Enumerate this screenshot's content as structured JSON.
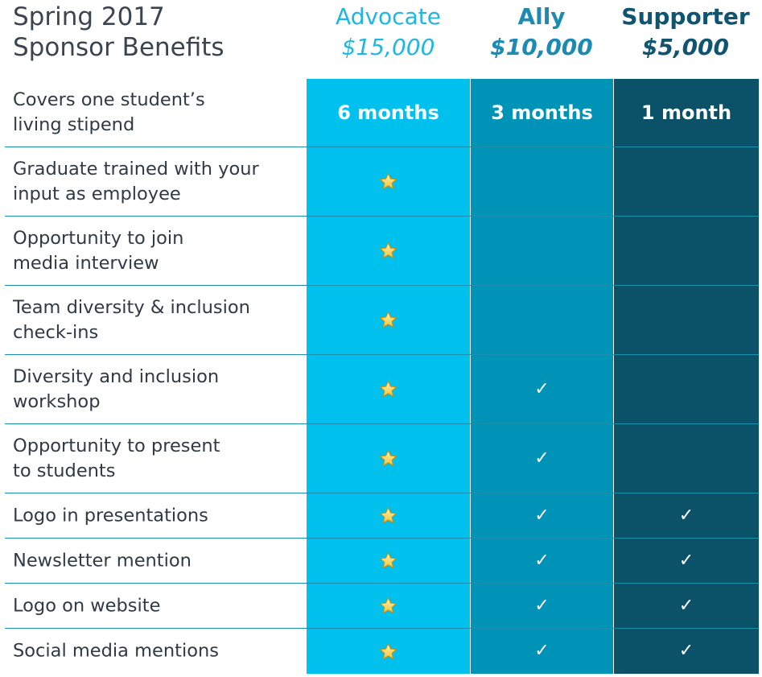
{
  "header": {
    "title_line1": "Spring 2017",
    "title_line2": "Sponsor Benefits"
  },
  "tiers": [
    {
      "name": "Advocate",
      "price": "$15,000",
      "color": "#00c0ee"
    },
    {
      "name": "Ally",
      "price": "$10,000",
      "color": "#0093b8"
    },
    {
      "name": "Supporter",
      "price": "$5,000",
      "color": "#0b5269"
    }
  ],
  "icons": {
    "star": "star-icon",
    "check": "check-icon",
    "check_glyph": "✓"
  },
  "rows": [
    {
      "label": "Covers one student’s\nliving stipend",
      "cells": [
        {
          "text": "6 months"
        },
        {
          "text": "3 months"
        },
        {
          "text": "1 month"
        }
      ]
    },
    {
      "label": "Graduate trained with your\ninput as employee",
      "cells": [
        "star",
        "",
        ""
      ]
    },
    {
      "label": "Opportunity to join\nmedia interview",
      "cells": [
        "star",
        "",
        ""
      ]
    },
    {
      "label": "Team diversity & inclusion\ncheck-ins",
      "cells": [
        "star",
        "",
        ""
      ]
    },
    {
      "label": "Diversity and inclusion\nworkshop",
      "cells": [
        "star",
        "check",
        ""
      ]
    },
    {
      "label": "Opportunity to present\nto students",
      "cells": [
        "star",
        "check",
        ""
      ]
    },
    {
      "label": "Logo in presentations",
      "cells": [
        "star",
        "check",
        "check"
      ]
    },
    {
      "label": "Newsletter mention",
      "cells": [
        "star",
        "check",
        "check"
      ]
    },
    {
      "label": "Logo on website",
      "cells": [
        "star",
        "check",
        "check"
      ]
    },
    {
      "label": "Social media mentions",
      "cells": [
        "star",
        "check",
        "check"
      ]
    }
  ]
}
